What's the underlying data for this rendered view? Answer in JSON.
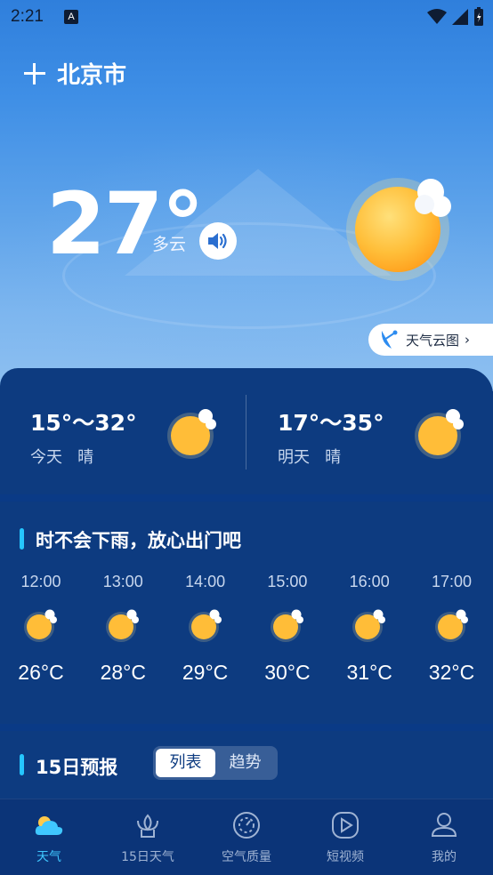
{
  "status_bar": {
    "time": "2:21",
    "notification_glyph": "A"
  },
  "header": {
    "city": "北京市"
  },
  "current": {
    "temperature": "27°",
    "condition": "多云"
  },
  "cloud_map": {
    "label": "天气云图"
  },
  "days": [
    {
      "range": "15°～32°",
      "label": "今天",
      "condition": "晴"
    },
    {
      "range": "17°～35°",
      "label": "明天",
      "condition": "晴"
    }
  ],
  "hourly": {
    "tip": "时不会下雨，放心出门吧",
    "hours": [
      {
        "time": "12:00",
        "temp": "26°C"
      },
      {
        "time": "13:00",
        "temp": "28°C"
      },
      {
        "time": "14:00",
        "temp": "29°C"
      },
      {
        "time": "15:00",
        "temp": "30°C"
      },
      {
        "time": "16:00",
        "temp": "31°C"
      },
      {
        "time": "17:00",
        "temp": "32°C"
      }
    ]
  },
  "forecast": {
    "title": "15日预报",
    "tabs": [
      "列表",
      "趋势"
    ],
    "active_tab": "列表"
  },
  "tabbar": {
    "items": [
      {
        "label": "天气",
        "icon": "cloud-icon"
      },
      {
        "label": "15日天气",
        "icon": "lotus-icon"
      },
      {
        "label": "空气质量",
        "icon": "gauge-icon"
      },
      {
        "label": "短视频",
        "icon": "play-icon"
      },
      {
        "label": "我的",
        "icon": "person-icon"
      }
    ],
    "active": "天气"
  },
  "colors": {
    "accent": "#3fc7ff",
    "card": "#0d3b80",
    "sun": "#ffb92e"
  }
}
